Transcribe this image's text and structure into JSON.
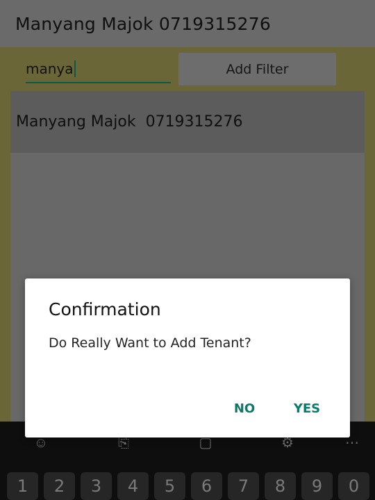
{
  "app_bar": {
    "title": "Manyang Majok 0719315276"
  },
  "filter": {
    "value": "manya",
    "button_label": "Add Filter"
  },
  "list": {
    "items": [
      {
        "label": "Manyang Majok  0719315276"
      }
    ]
  },
  "dialog": {
    "title": "Confirmation",
    "message": "Do Really Want to Add Tenant?",
    "no_label": "NO",
    "yes_label": "YES"
  },
  "keyboard": {
    "toolbar_icons": [
      "emoji-icon",
      "translate-icon",
      "clipboard-icon",
      "settings-icon",
      "more-icon"
    ],
    "number_keys": [
      "1",
      "2",
      "3",
      "4",
      "5",
      "6",
      "7",
      "8",
      "9",
      "0"
    ]
  },
  "colors": {
    "accent": "#0a7a6a",
    "content_background": "#6b6637",
    "dialog_background": "#ffffff"
  }
}
